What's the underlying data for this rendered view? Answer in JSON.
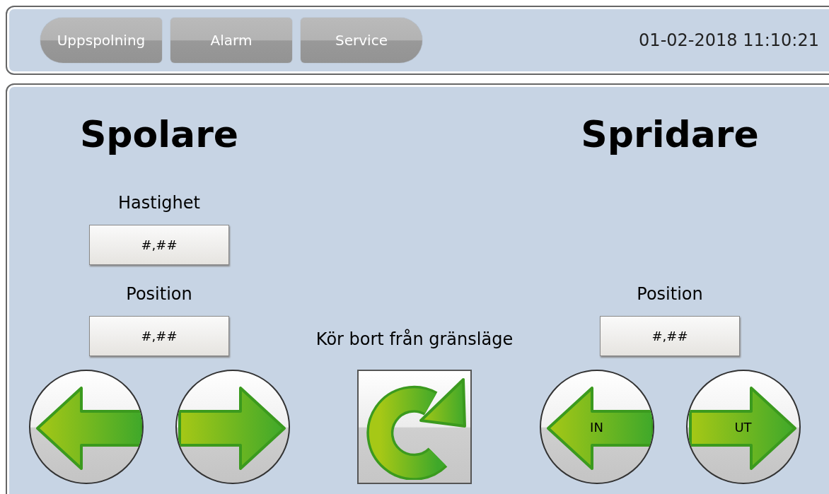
{
  "nav": [
    {
      "label": "Uppspolning",
      "kind": "pill-left"
    },
    {
      "label": "Alarm",
      "kind": "square"
    },
    {
      "label": "Service",
      "kind": "pill-right"
    }
  ],
  "datetime": "01-02-2018 11:10:21",
  "spolare": {
    "title": "Spolare",
    "fields": [
      {
        "label": "Hastighet",
        "value": "#,##"
      },
      {
        "label": "Position",
        "value": "#,##"
      }
    ],
    "buttons": [
      {
        "kind": "left"
      },
      {
        "kind": "right"
      }
    ]
  },
  "center": {
    "label": "Kör bort från gränsläge"
  },
  "spridare": {
    "title": "Spridare",
    "fields": [
      {
        "label": "Position",
        "value": "#,##"
      }
    ],
    "buttons": [
      {
        "kind": "left",
        "label": "IN"
      },
      {
        "kind": "right",
        "label": "UT"
      }
    ]
  }
}
